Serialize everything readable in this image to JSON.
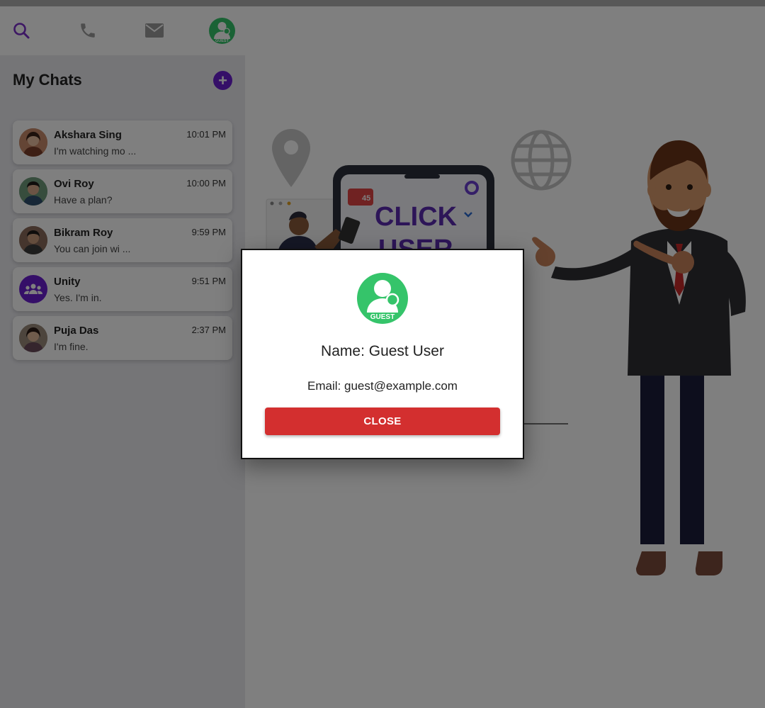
{
  "colors": {
    "accent": "#6a1fd0",
    "guest_green": "#35c46a",
    "close_red": "#d32f2f"
  },
  "nav": {
    "icons": [
      "search-icon",
      "phone-icon",
      "mail-icon",
      "guest-avatar"
    ],
    "avatar_label": "GUEST"
  },
  "sidebar": {
    "title": "My Chats",
    "add_label": "+"
  },
  "chats": [
    {
      "name": "Akshara Sing",
      "preview": "I'm watching mo ...",
      "time": "10:01 PM"
    },
    {
      "name": "Ovi Roy",
      "preview": "Have a plan?",
      "time": "10:00 PM"
    },
    {
      "name": "Bikram Roy",
      "preview": "You can join wi ...",
      "time": "9:59 PM"
    },
    {
      "name": "Unity",
      "preview": "Yes. I'm in.",
      "time": "9:51 PM"
    },
    {
      "name": "Puja Das",
      "preview": "I'm fine.",
      "time": "2:37 PM"
    }
  ],
  "illustration": {
    "badge_count": "45",
    "phone_text_1": "CLICK",
    "phone_text_2": "USER"
  },
  "modal": {
    "avatar_label": "GUEST",
    "name": "Name: Guest User",
    "email": "Email: guest@example.com",
    "close_label": "CLOSE"
  }
}
